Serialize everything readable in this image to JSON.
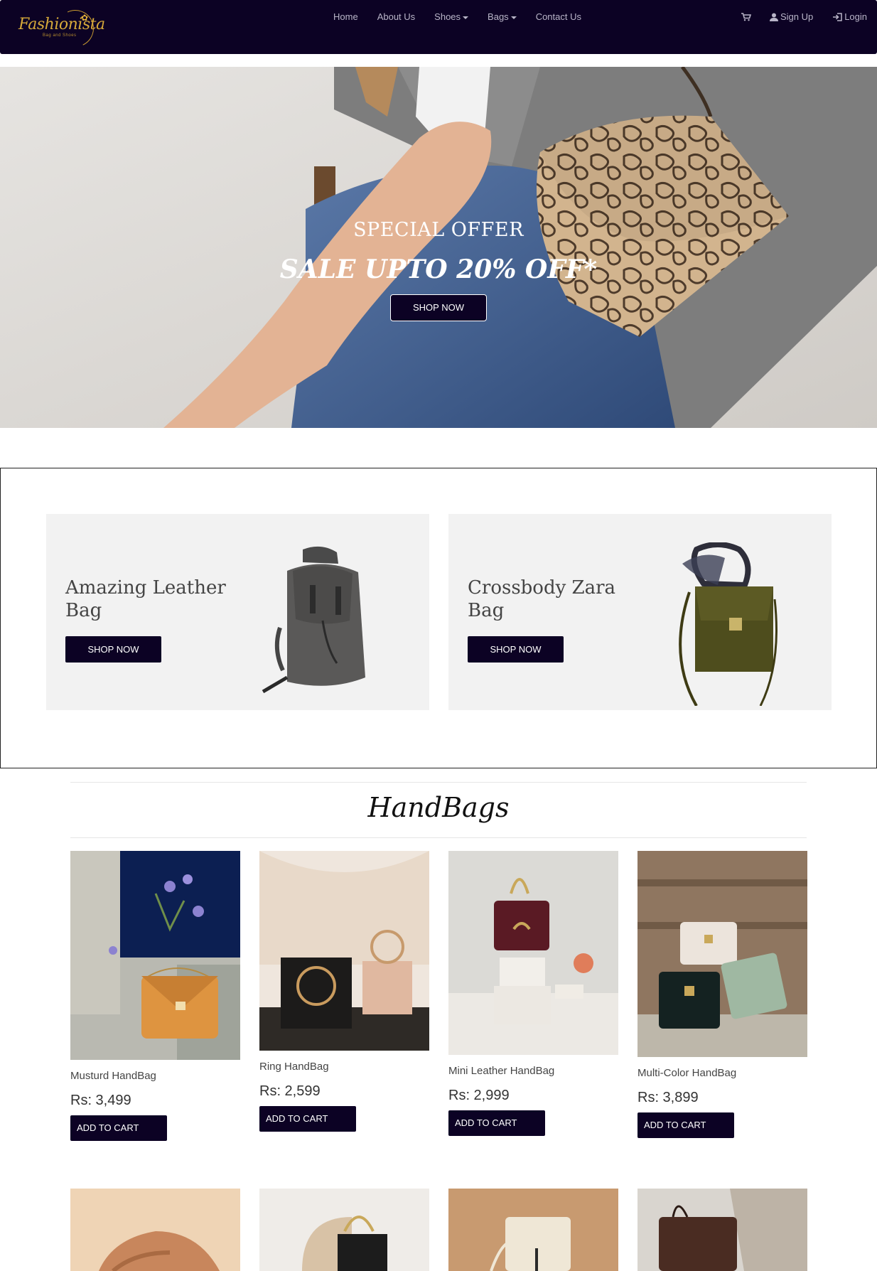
{
  "brand": {
    "logo_text": "Fashionista",
    "logo_tagline": "Bag and Shoes"
  },
  "nav": {
    "links": [
      {
        "label": "Home",
        "dropdown": false
      },
      {
        "label": "About Us",
        "dropdown": false
      },
      {
        "label": "Shoes",
        "dropdown": true
      },
      {
        "label": "Bags",
        "dropdown": true
      },
      {
        "label": "Contact Us",
        "dropdown": false
      }
    ],
    "signup_label": "Sign Up",
    "login_label": "Login",
    "cart_icon": "shopping-cart-icon",
    "signup_icon": "user-icon",
    "login_icon": "log-in-icon"
  },
  "hero": {
    "kicker": "SPECIAL OFFER",
    "headline": "SALE UPTO 20% OFF*",
    "button_label": "SHOP NOW"
  },
  "promos": [
    {
      "title": "Amazing Leather Bag",
      "button_label": "SHOP NOW",
      "image": "backpack"
    },
    {
      "title": "Crossbody Zara Bag",
      "button_label": "SHOP NOW",
      "image": "crossbody-bag"
    }
  ],
  "handbags": {
    "title": "HandBags",
    "products": [
      {
        "name": "Musturd HandBag",
        "price": "Rs: 3,499",
        "button_label": "ADD TO CART"
      },
      {
        "name": "Ring HandBag",
        "price": "Rs: 2,599",
        "button_label": "ADD TO CART"
      },
      {
        "name": "Mini Leather HandBag",
        "price": "Rs: 2,999",
        "button_label": "ADD TO CART"
      },
      {
        "name": "Multi-Color HandBag",
        "price": "Rs: 3,899",
        "button_label": "ADD TO CART"
      }
    ]
  },
  "colors": {
    "navbar": "#0c0224",
    "button": "#0c0224",
    "promo_bg": "#f2f2f2"
  }
}
